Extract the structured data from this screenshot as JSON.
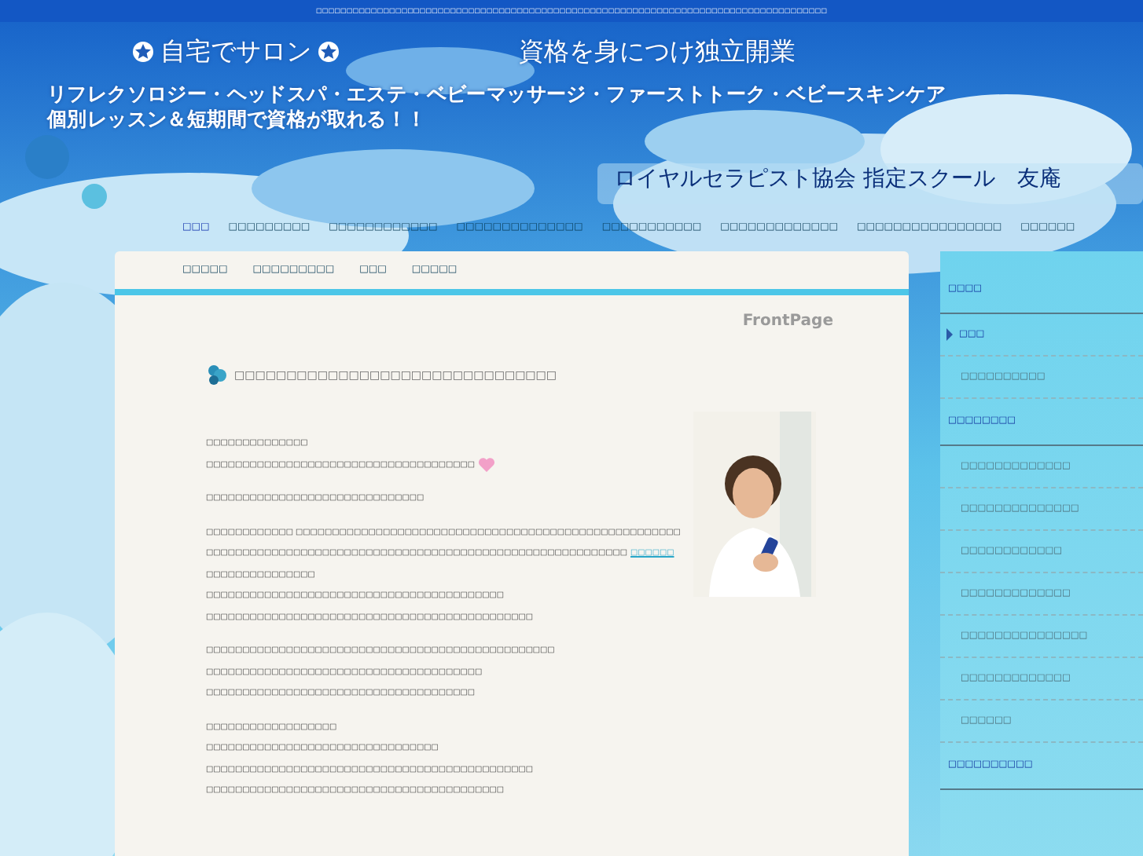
{
  "top_text": "□□□□□□□□□□□□□□□□□□□□□□□□□□□□□□□□□□□□□□□□□□□□□□□□□□□□□□□□□□□□□□□□□□□□□□□□□□□□□□□□□□□□",
  "banner": {
    "salon": "自宅でサロン",
    "independent": "資格を身につけ独立開業",
    "courses": "リフレクソロジー・ヘッドスパ・エステ・ベビーマッサージ・ファーストトーク・ベビースキンケア",
    "lesson": "個別レッスン＆短期間で資格が取れる！！",
    "school": "ロイヤルセラピスト協会  指定スクール　友庵"
  },
  "nav": [
    {
      "label": "□□□",
      "selected": true
    },
    {
      "label": "□□□□□□□□□",
      "selected": false
    },
    {
      "label": "□□□□□□□□□□□□",
      "selected": false
    },
    {
      "label": "□□□□□□□□□□□□□□",
      "selected": false
    },
    {
      "label": "□□□□□□□□□□□",
      "selected": false
    },
    {
      "label": "□□□□□□□□□□□□□",
      "selected": false
    },
    {
      "label": "□□□□□□□□□□□□□□□□",
      "selected": false
    },
    {
      "label": "□□□□□□",
      "selected": false
    },
    {
      "label": "□□□□□",
      "selected": false
    },
    {
      "label": "□□□□□□□□□",
      "selected": false
    },
    {
      "label": "□□□",
      "selected": false
    },
    {
      "label": "□□□□□",
      "selected": false
    }
  ],
  "page_label": "FrontPage",
  "heading": "□□□□□□□□□□□□□□□□□□□□□□□□□□□□□□□",
  "paragraphs": [
    [
      {
        "text": "□□□□□□□□□□□□□□"
      },
      {
        "text": "□□□□□□□□□□□□□□□□□□□□□□□□□□□□□□□□□□□□□",
        "heart": true
      }
    ],
    [
      {
        "text": "□□□□□□□□□□□□□□□□□□□□□□□□□□□□□□"
      }
    ],
    [
      {
        "text": "□□□□□□□□□□□□ □□□□□□□□□□□□□□□□□□□□□□□□□□□□□□□□□□□□□□□□□□□□□□□□□□□□□"
      },
      {
        "text": "□□□□□□□□□□□□□□□□□□□□□□□□□□□□□□□□□□□□□□□□□□□□□□□□□□□□□□□□□□",
        "link": "□□□□□□"
      },
      {
        "text": "□□□□□□□□□□□□□□□"
      },
      {
        "text": "□□□□□□□□□□□□□□□□□□□□□□□□□□□□□□□□□□□□□□□□□"
      },
      {
        "text": "□□□□□□□□□□□□□□□□□□□□□□□□□□□□□□□□□□□□□□□□□□□□□"
      }
    ],
    [
      {
        "text": "□□□□□□□□□□□□□□□□□□□□□□□□□□□□□□□□□□□□□□□□□□□□□□□□"
      },
      {
        "text": "□□□□□□□□□□□□□□□□□□□□□□□□□□□□□□□□□□□□□□"
      },
      {
        "text": "□□□□□□□□□□□□□□□□□□□□□□□□□□□□□□□□□□□□□"
      }
    ],
    [
      {
        "text": "□□□□□□□□□□□□□□□□□□"
      },
      {
        "text": "□□□□□□□□□□□□□□□□□□□□□□□□□□□□□□□□"
      },
      {
        "text": "□□□□□□□□□□□□□□□□□□□□□□□□□□□□□□□□□□□□□□□□□□□□□"
      },
      {
        "text": "□□□□□□□□□□□□□□□□□□□□□□□□□□□□□□□□□□□□□□□□□"
      }
    ]
  ],
  "sidebar": [
    {
      "kind": "header",
      "label": "□□□□"
    },
    {
      "kind": "item",
      "label": "□□□",
      "selected": true
    },
    {
      "kind": "item",
      "label": "□□□□□□□□□□",
      "selected": false
    },
    {
      "kind": "header",
      "label": "□□□□□□□□"
    },
    {
      "kind": "item",
      "label": "□□□□□□□□□□□□□",
      "selected": false
    },
    {
      "kind": "item",
      "label": "□□□□□□□□□□□□□□",
      "selected": false
    },
    {
      "kind": "item",
      "label": "□□□□□□□□□□□□",
      "selected": false
    },
    {
      "kind": "item",
      "label": "□□□□□□□□□□□□□",
      "selected": false
    },
    {
      "kind": "item",
      "label": "□□□□□□□□□□□□□□□",
      "selected": false
    },
    {
      "kind": "item",
      "label": "□□□□□□□□□□□□□",
      "selected": false
    },
    {
      "kind": "item",
      "label": "□□□□□□",
      "selected": false
    },
    {
      "kind": "header",
      "label": "□□□□□□□□□□"
    }
  ]
}
